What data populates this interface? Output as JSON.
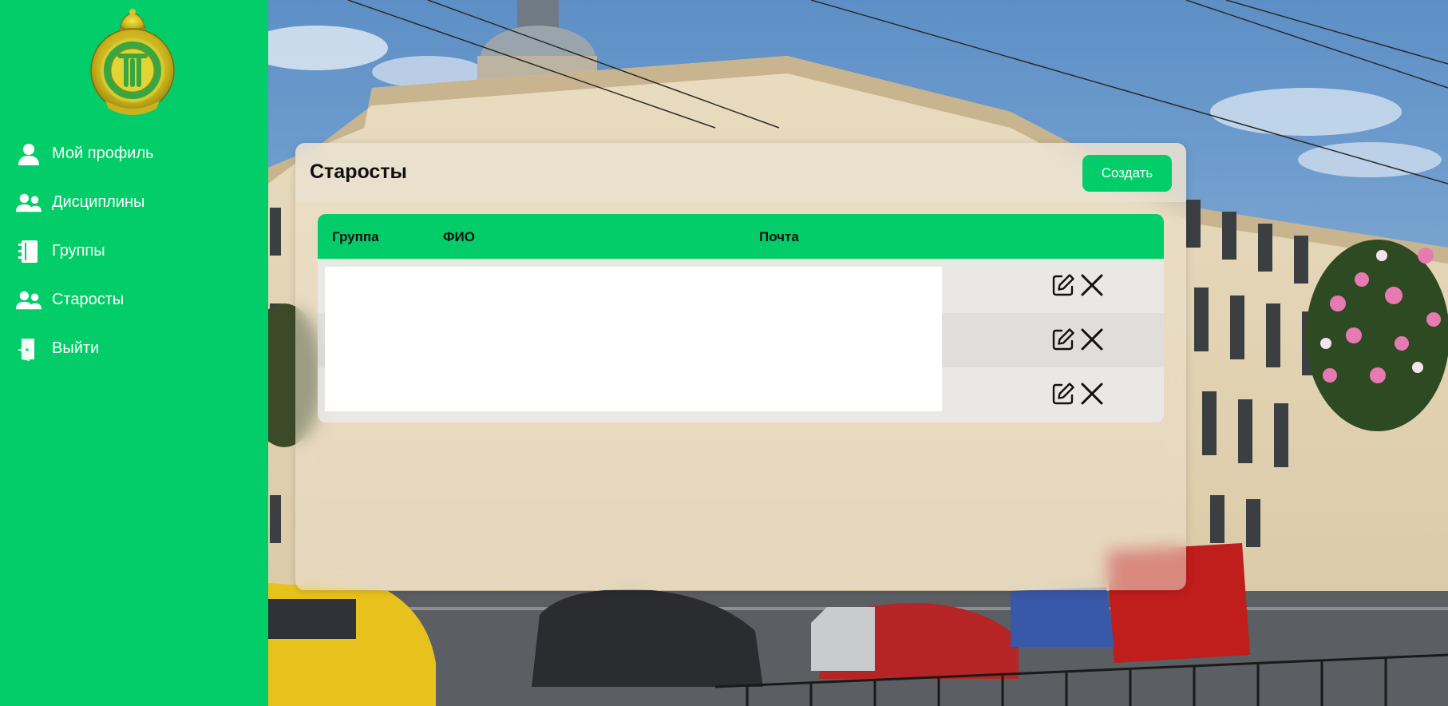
{
  "sidebar": {
    "logo_icon": "institute-emblem-icon",
    "items": [
      {
        "label": "Мой профиль",
        "icon": "user-icon"
      },
      {
        "label": "Дисциплины",
        "icon": "users-icon"
      },
      {
        "label": "Группы",
        "icon": "notebook-icon"
      },
      {
        "label": "Старосты",
        "icon": "users-icon"
      },
      {
        "label": "Выйти",
        "icon": "door-exit-icon"
      }
    ]
  },
  "page": {
    "title": "Старосты",
    "create_label": "Создать"
  },
  "table": {
    "columns": [
      "Группа",
      "ФИО",
      "Почта"
    ],
    "rows": [
      {
        "group": "",
        "name": "",
        "email": ""
      },
      {
        "group": "",
        "name": "",
        "email": ""
      },
      {
        "group": "",
        "name": "",
        "email": ""
      }
    ],
    "row_actions": [
      "edit-icon",
      "close-icon"
    ]
  },
  "colors": {
    "accent": "#03cd69",
    "text_on_accent": "#ffffff",
    "title_text": "#111111"
  }
}
